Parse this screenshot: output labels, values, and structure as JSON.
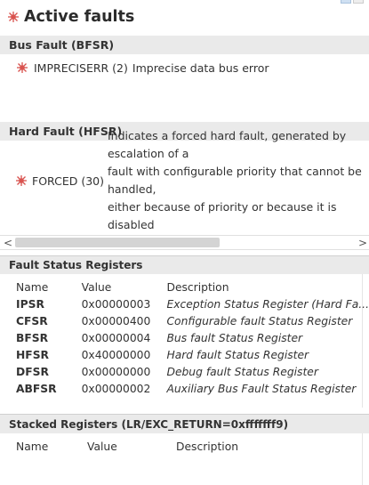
{
  "title": "Active faults",
  "sections": {
    "bus_fault": {
      "header": "Bus Fault (BFSR)",
      "code": "IMPRECISERR (2)",
      "description": "Imprecise data bus error"
    },
    "hard_fault": {
      "header": "Hard Fault (HFSR)",
      "code": "FORCED (30)",
      "description": "Indicates a forced hard fault, generated by escalation of a\nfault with configurable priority that cannot be handled,\neither because of priority or because it is disabled"
    }
  },
  "scrollbar": {
    "left_arrow": "<",
    "right_arrow": ">"
  },
  "fault_status": {
    "title": "Fault Status Registers",
    "columns": [
      "Name",
      "Value",
      "Description"
    ],
    "rows": [
      {
        "name": "IPSR",
        "value": "0x00000003",
        "description": "Exception Status Register (Hard Fa..."
      },
      {
        "name": "CFSR",
        "value": "0x00000400",
        "description": "Configurable fault Status Register"
      },
      {
        "name": "BFSR",
        "value": "0x00000004",
        "description": "Bus fault Status Register"
      },
      {
        "name": "HFSR",
        "value": "0x40000000",
        "description": "Hard fault Status Register"
      },
      {
        "name": "DFSR",
        "value": "0x00000000",
        "description": "Debug fault Status Register"
      },
      {
        "name": "ABFSR",
        "value": "0x00000002",
        "description": "Auxiliary Bus Fault Status Register"
      }
    ]
  },
  "stacked": {
    "title": "Stacked Registers (LR/EXC_RETURN=0xfffffff9)",
    "columns": [
      "Name",
      "Value",
      "Description"
    ]
  },
  "colors": {
    "fault_icon": "#d9534f",
    "section_bg": "#eaeaea"
  },
  "icons": {
    "fault": "bug-icon"
  }
}
